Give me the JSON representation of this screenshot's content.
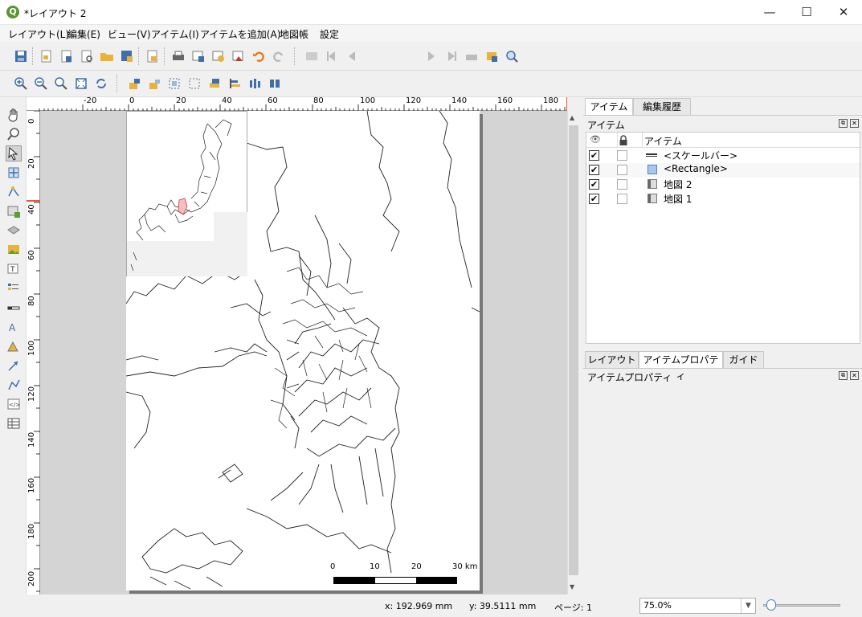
{
  "window": {
    "title": "*レイアウト 2",
    "controls": {
      "minimize": "—",
      "maximize": "☐",
      "close": "✕"
    }
  },
  "menu": [
    "レイアウト(L)",
    "編集(E)",
    "ビュー(V)",
    "アイテム(I)",
    "アイテムを追加(A)",
    "地図帳",
    "設定"
  ],
  "toolbar1": {
    "page_value": "1"
  },
  "ruler": {
    "h_ticks": [
      "-20",
      "0",
      "20",
      "40",
      "60",
      "80",
      "100",
      "120",
      "140",
      "160",
      "180"
    ],
    "v_ticks": [
      "0",
      "20",
      "40",
      "60",
      "80",
      "100",
      "120",
      "140",
      "160",
      "180",
      "200"
    ]
  },
  "scalebar": {
    "labels": [
      "0",
      "10",
      "20",
      "30 km"
    ]
  },
  "right_panel": {
    "top_tabs": [
      "アイテム",
      "編集履歴"
    ],
    "items_title": "アイテム",
    "column_header": "アイテム",
    "items": [
      {
        "label": "<スケールバー>",
        "visible": true,
        "locked": false,
        "icon": "scalebar-icon"
      },
      {
        "label": "<Rectangle>",
        "visible": true,
        "locked": false,
        "icon": "rectangle-icon"
      },
      {
        "label": "地図 2",
        "visible": true,
        "locked": false,
        "icon": "map-icon"
      },
      {
        "label": "地図 1",
        "visible": true,
        "locked": false,
        "icon": "map-icon"
      }
    ],
    "bottom_tabs": [
      "レイアウト",
      "アイテムプロパティ",
      "ガイド"
    ],
    "props_title": "アイテムプロパティ",
    "check": "✔"
  },
  "status": {
    "x": "x: 192.969 mm",
    "y": "y: 39.5111 mm",
    "page": "ページ: 1",
    "zoom": "75.0%"
  }
}
